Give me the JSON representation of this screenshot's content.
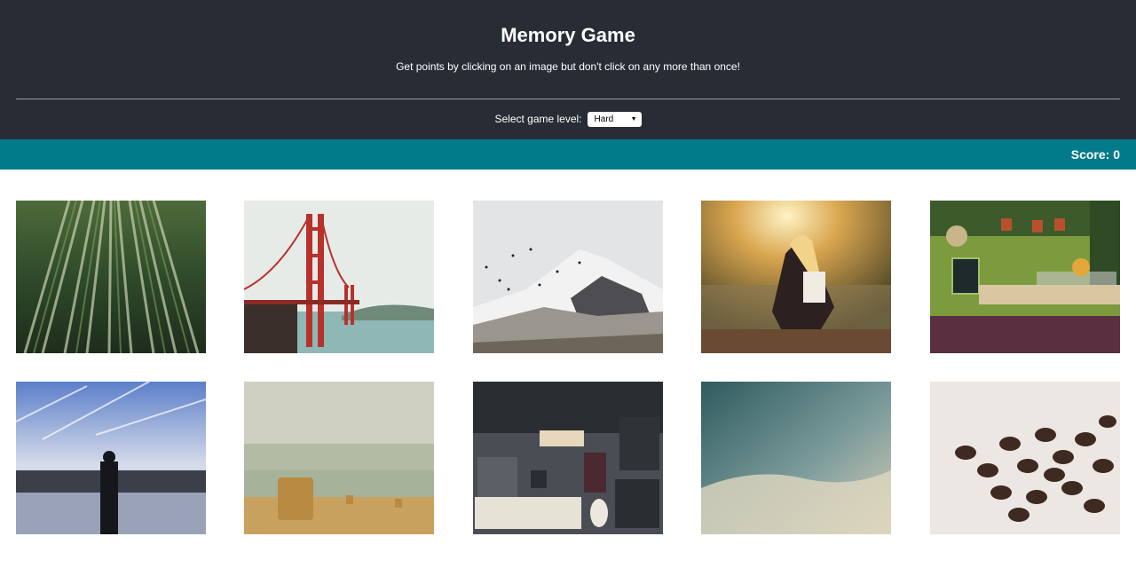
{
  "header": {
    "title": "Memory Game",
    "subtitle": "Get points by clicking on an image but don't click on any more than once!",
    "level_label": "Select game level:",
    "level_value": "Hard"
  },
  "scorebar": {
    "score_text": "Score: 0"
  },
  "colors": {
    "header_bg": "#282c34",
    "scorebar_bg": "#017a8a"
  },
  "images": [
    {
      "name": "bamboo-forest-image"
    },
    {
      "name": "golden-gate-bridge-image"
    },
    {
      "name": "snowy-mountain-birds-image"
    },
    {
      "name": "woman-sunset-lake-image"
    },
    {
      "name": "cafe-terrace-image"
    },
    {
      "name": "man-lake-silhouette-image"
    },
    {
      "name": "hay-bale-field-image"
    },
    {
      "name": "desk-workspace-image"
    },
    {
      "name": "cloudy-sky-image"
    },
    {
      "name": "coffee-beans-image"
    }
  ]
}
